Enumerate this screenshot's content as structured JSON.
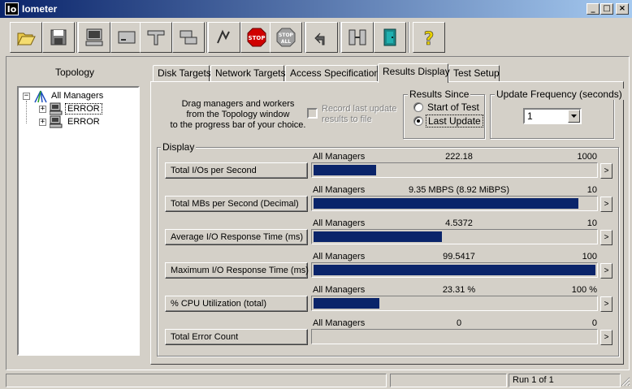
{
  "window": {
    "title": "Iometer",
    "icon_text": "Io",
    "minimize": "_",
    "maximize": "□",
    "close": "×"
  },
  "toolbar": {
    "buttons": [
      {
        "name": "open-config",
        "icon": "folder-open-icon"
      },
      {
        "name": "save-config",
        "icon": "floppy-disk-icon"
      },
      {
        "name": "start-new-manager",
        "icon": "computer-icon"
      },
      {
        "name": "start-new-disk-worker",
        "icon": "disk-worker-icon"
      },
      {
        "name": "start-new-network-worker",
        "icon": "network-worker-icon"
      },
      {
        "name": "copy-worker",
        "icon": "copy-worker-icon"
      },
      {
        "name": "start-tests",
        "icon": "green-flag-icon"
      },
      {
        "name": "stop",
        "icon": "stop-sign-icon",
        "label": "STOP"
      },
      {
        "name": "stop-all",
        "icon": "stop-all-icon",
        "label": "STOP",
        "sublabel": "ALL"
      },
      {
        "name": "reset-workers",
        "icon": "undo-arrow-icon"
      },
      {
        "name": "disconnect",
        "icon": "network-disconnect-icon"
      },
      {
        "name": "exit",
        "icon": "exit-door-icon"
      },
      {
        "name": "about",
        "icon": "help-question-icon",
        "label": "?"
      }
    ]
  },
  "topology": {
    "title": "Topology",
    "root": {
      "label": "All Managers",
      "expand": "−"
    },
    "managers": [
      {
        "label": "ERROR",
        "expand": "+",
        "selected": true
      },
      {
        "label": "ERROR",
        "expand": "+",
        "selected": false
      }
    ]
  },
  "tabs": [
    {
      "label": "Disk Targets",
      "active": false
    },
    {
      "label": "Network Targets",
      "active": false
    },
    {
      "label": "Access Specifications",
      "active": false
    },
    {
      "label": "Results Display",
      "active": true
    },
    {
      "label": "Test Setup",
      "active": false
    }
  ],
  "results_display": {
    "instructions": [
      "Drag managers and workers",
      "from the Topology window",
      "to the progress bar of your choice."
    ],
    "record_label": [
      "Record last update",
      "results to file"
    ],
    "record_checked": false,
    "results_since": {
      "title": "Results Since",
      "options": [
        {
          "label": "Start of Test",
          "selected": false
        },
        {
          "label": "Last Update",
          "selected": true
        }
      ]
    },
    "update_frequency": {
      "title": "Update Frequency (seconds)",
      "value": "1"
    },
    "display_title": "Display",
    "metrics": [
      {
        "label": "Total I/Os per Second",
        "source": "All Managers",
        "value": "222.18",
        "max": "1000",
        "fraction": 0.222,
        "arrow": ">"
      },
      {
        "label": "Total MBs per Second (Decimal)",
        "source": "All Managers",
        "value": "9.35 MBPS (8.92 MiBPS)",
        "max": "10",
        "fraction": 0.935,
        "arrow": ">"
      },
      {
        "label": "Average I/O Response Time (ms)",
        "source": "All Managers",
        "value": "4.5372",
        "max": "10",
        "fraction": 0.454,
        "arrow": ">"
      },
      {
        "label": "Maximum I/O Response Time (ms)",
        "source": "All Managers",
        "value": "99.5417",
        "max": "100",
        "fraction": 0.995,
        "arrow": ">"
      },
      {
        "label": "% CPU Utilization (total)",
        "source": "All Managers",
        "value": "23.31 %",
        "max": "100 %",
        "fraction": 0.233,
        "arrow": ">"
      },
      {
        "label": "Total Error Count",
        "source": "All Managers",
        "value": "0",
        "max": "0",
        "fraction": 0,
        "arrow": ">"
      }
    ]
  },
  "statusbar": {
    "pane1": "",
    "pane2": "",
    "run_status": "Run 1 of 1"
  },
  "colors": {
    "titlebar_start": "#0a246a",
    "titlebar_end": "#a6caf0",
    "bar_fill": "#0a246a",
    "face": "#d4d0c8"
  }
}
